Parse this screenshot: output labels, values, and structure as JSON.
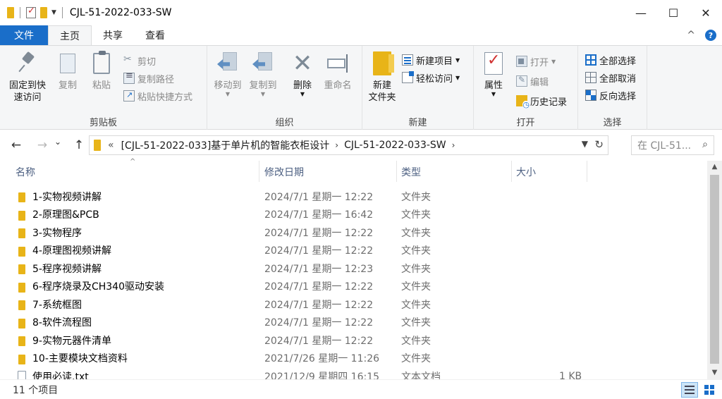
{
  "window": {
    "title": "CJL-51-2022-033-SW",
    "minimize_glyph": "—",
    "maximize_glyph": "☐",
    "close_glyph": "✕"
  },
  "tabs": {
    "file": "文件",
    "home": "主页",
    "share": "共享",
    "view": "查看",
    "collapse_glyph": "^",
    "help_glyph": "?"
  },
  "ribbon": {
    "clipboard": {
      "label": "剪贴板",
      "pin": "固定到快\n速访问",
      "copy": "复制",
      "paste": "粘贴",
      "cut": "剪切",
      "copy_path": "复制路径",
      "paste_shortcut": "粘贴快捷方式"
    },
    "organize": {
      "label": "组织",
      "move_to": "移动到",
      "copy_to": "复制到",
      "delete": "删除",
      "rename": "重命名"
    },
    "new": {
      "label": "新建",
      "new_folder": "新建\n文件夹",
      "new_item": "新建项目",
      "easy_access": "轻松访问"
    },
    "open": {
      "label": "打开",
      "properties": "属性",
      "open": "打开",
      "edit": "编辑",
      "history": "历史记录"
    },
    "select": {
      "label": "选择",
      "select_all": "全部选择",
      "select_none": "全部取消",
      "invert": "反向选择"
    }
  },
  "nav": {
    "back": "←",
    "forward": "→",
    "recent": "⌄",
    "up": "↑",
    "overflow": "«",
    "crumbs": [
      "[CJL-51-2022-033]基于单片机的智能衣柜设计",
      "CJL-51-2022-033-SW"
    ],
    "crumb_sep": "›",
    "search_placeholder": "在 CJL-51..."
  },
  "columns": {
    "name": "名称",
    "date": "修改日期",
    "type": "类型",
    "size": "大小"
  },
  "files": [
    {
      "name": "1-实物视频讲解",
      "date": "2024/7/1 星期一 12:22",
      "type": "文件夹",
      "size": "",
      "kind": "folder"
    },
    {
      "name": "2-原理图&PCB",
      "date": "2024/7/1 星期一 16:42",
      "type": "文件夹",
      "size": "",
      "kind": "folder"
    },
    {
      "name": "3-实物程序",
      "date": "2024/7/1 星期一 12:22",
      "type": "文件夹",
      "size": "",
      "kind": "folder"
    },
    {
      "name": "4-原理图视频讲解",
      "date": "2024/7/1 星期一 12:22",
      "type": "文件夹",
      "size": "",
      "kind": "folder"
    },
    {
      "name": "5-程序视频讲解",
      "date": "2024/7/1 星期一 12:23",
      "type": "文件夹",
      "size": "",
      "kind": "folder"
    },
    {
      "name": "6-程序烧录及CH340驱动安装",
      "date": "2024/7/1 星期一 12:22",
      "type": "文件夹",
      "size": "",
      "kind": "folder"
    },
    {
      "name": "7-系统框图",
      "date": "2024/7/1 星期一 12:22",
      "type": "文件夹",
      "size": "",
      "kind": "folder"
    },
    {
      "name": "8-软件流程图",
      "date": "2024/7/1 星期一 12:22",
      "type": "文件夹",
      "size": "",
      "kind": "folder"
    },
    {
      "name": "9-实物元器件清单",
      "date": "2024/7/1 星期一 12:22",
      "type": "文件夹",
      "size": "",
      "kind": "folder"
    },
    {
      "name": "10-主要模块文档资料",
      "date": "2021/7/26 星期一 11:26",
      "type": "文件夹",
      "size": "",
      "kind": "folder"
    },
    {
      "name": "使用必读.txt",
      "date": "2021/12/9 星期四 16:15",
      "type": "文本文档",
      "size": "1 KB",
      "kind": "txt"
    }
  ],
  "status": {
    "count": "11 个项目"
  },
  "colors": {
    "accent": "#1a6ec9",
    "folder": "#e8b418"
  }
}
